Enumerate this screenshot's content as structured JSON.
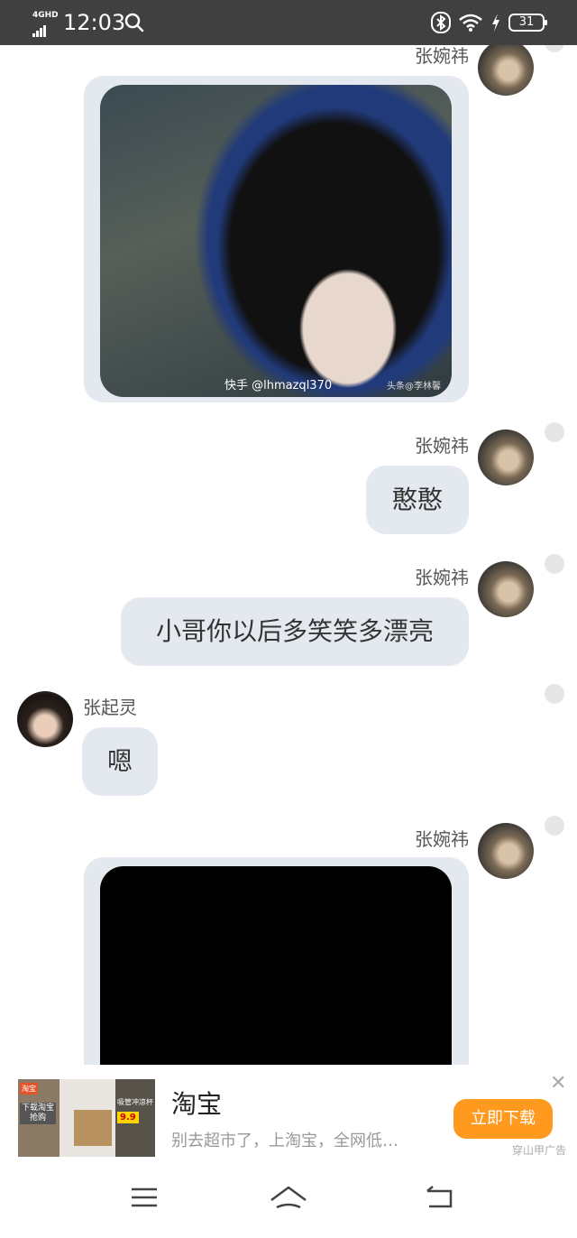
{
  "status_bar": {
    "network": "4GHD",
    "time": "12:03",
    "battery": "31"
  },
  "messages": [
    {
      "type": "image",
      "sender": "张婉祎",
      "side": "right",
      "watermark_left": "快手 @lhmazql370",
      "watermark_right": "头条@李林馨"
    },
    {
      "type": "text",
      "sender": "张婉祎",
      "side": "right",
      "text": "憨憨"
    },
    {
      "type": "text",
      "sender": "张婉祎",
      "side": "right",
      "text": "小哥你以后多笑笑多漂亮"
    },
    {
      "type": "text",
      "sender": "张起灵",
      "side": "left",
      "text": "嗯"
    },
    {
      "type": "video",
      "sender": "张婉祎",
      "side": "right"
    }
  ],
  "ad": {
    "title": "淘宝",
    "description": "别去超市了，上淘宝，全网低…",
    "button": "立即下载",
    "source": "穿山甲广告",
    "thumb_tag": "淘宝",
    "thumb_line1": "下载淘宝抢购",
    "thumb_line2": "吸管冲凉杯",
    "thumb_price": "9.9"
  },
  "colors": {
    "status_bar": "#404040",
    "bubble": "#e4e9f0",
    "ad_button": "#ff9a1f"
  },
  "icons": {
    "nav": [
      "menu-icon",
      "home-icon",
      "back-icon"
    ]
  }
}
